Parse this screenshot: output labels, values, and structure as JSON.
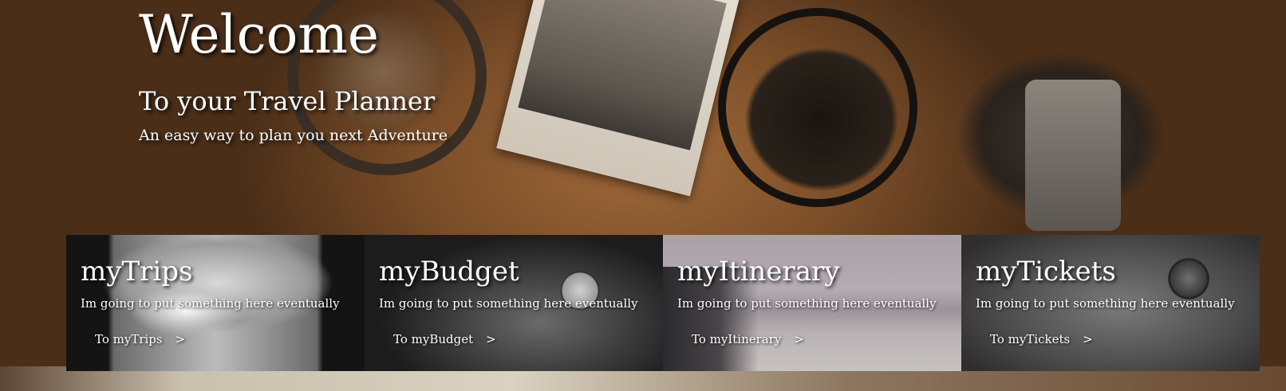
{
  "hero": {
    "title": "Welcome",
    "subtitle": "To your Travel Planner",
    "tagline": "An easy way to plan you next Adventure"
  },
  "cards": [
    {
      "title": "myTrips",
      "text": "Im going to put something here eventually",
      "link": "To myTrips",
      "chevron": ">"
    },
    {
      "title": "myBudget",
      "text": "Im going to put something here eventually",
      "link": "To myBudget",
      "chevron": ">"
    },
    {
      "title": "myItinerary",
      "text": "Im going to put something here eventually",
      "link": "To myItinerary",
      "chevron": ">"
    },
    {
      "title": "myTickets",
      "text": "Im going to put something here eventually",
      "link": "To myTickets",
      "chevron": ">"
    }
  ]
}
